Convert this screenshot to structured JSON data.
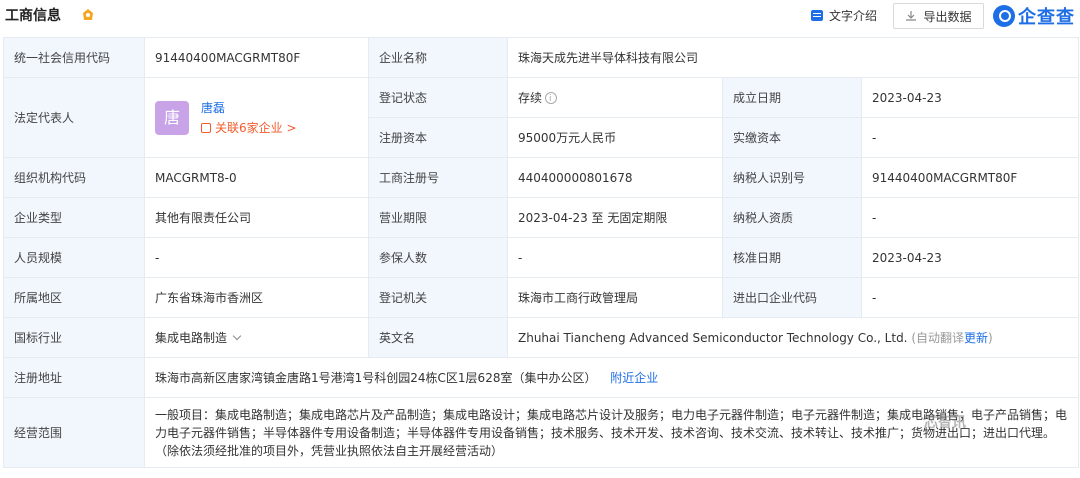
{
  "header": {
    "title": "工商信息",
    "intro_label": "文字介绍",
    "export_label": "导出数据",
    "brand": "企查查"
  },
  "rows": {
    "credit_code_label": "统一社会信用代码",
    "credit_code": "91440400MACGRMT80F",
    "company_name_label": "企业名称",
    "company_name": "珠海天成先进半导体科技有限公司",
    "legal_rep_label": "法定代表人",
    "legal_rep_avatar": "唐",
    "legal_rep_name": "唐磊",
    "legal_rep_related": "关联6家企业 >",
    "reg_status_label": "登记状态",
    "reg_status": "存续",
    "found_date_label": "成立日期",
    "found_date": "2023-04-23",
    "reg_capital_label": "注册资本",
    "reg_capital": "95000万元人民币",
    "paid_capital_label": "实缴资本",
    "paid_capital": "-",
    "org_code_label": "组织机构代码",
    "org_code": "MACGRMT8-0",
    "biz_reg_no_label": "工商注册号",
    "biz_reg_no": "440400000801678",
    "taxpayer_id_label": "纳税人识别号",
    "taxpayer_id": "91440400MACGRMT80F",
    "company_type_label": "企业类型",
    "company_type": "其他有限责任公司",
    "biz_term_label": "营业期限",
    "biz_term": "2023-04-23 至 无固定期限",
    "taxpayer_qual_label": "纳税人资质",
    "taxpayer_qual": "-",
    "staff_size_label": "人员规模",
    "staff_size": "-",
    "insured_label": "参保人数",
    "insured": "-",
    "approval_date_label": "核准日期",
    "approval_date": "2023-04-23",
    "region_label": "所属地区",
    "region": "广东省珠海市香洲区",
    "reg_authority_label": "登记机关",
    "reg_authority": "珠海市工商行政管理局",
    "import_export_label": "进出口企业代码",
    "import_export": "-",
    "industry_label": "国标行业",
    "industry": "集成电路制造",
    "english_name_label": "英文名",
    "english_name": "Zhuhai Tiancheng Advanced Semiconductor Technology Co., Ltd.",
    "auto_translate": "(自动翻译",
    "update_link": "更新",
    "auto_translate_end": ")",
    "address_label": "注册地址",
    "address": "珠海市高新区唐家湾镇金唐路1号港湾1号科创园24栋C区1层628室（集中办公区）",
    "nearby_link": "附近企业",
    "scope_label": "经营范围",
    "scope": "一般项目：集成电路制造；集成电路芯片及产品制造；集成电路设计；集成电路芯片设计及服务；电力电子元器件制造；电子元器件制造；集成电路销售；电子产品销售；电力电子元器件销售；半导体器件专用设备制造；半导体器件专用设备销售；技术服务、技术开发、技术咨询、技术交流、技术转让、技术推广；货物进出口；进出口代理。（除依法须经批准的项目外，凭营业执照依法自主开展经营活动）"
  },
  "watermark": "芯智讯",
  "colors": {
    "accent": "#1e6fe6",
    "label_bg": "#f2f7fe",
    "border": "#e6ebf2",
    "relation": "#f25c2c",
    "avatar": "#c8a3e8",
    "badge": "#f5a623"
  }
}
